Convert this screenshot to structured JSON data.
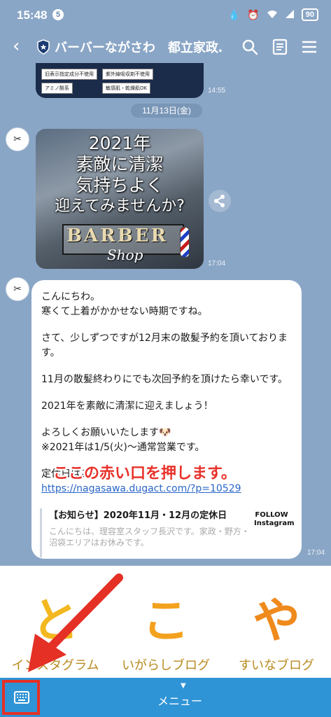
{
  "status_bar": {
    "time": "15:48",
    "notification_count": "5",
    "battery": "90"
  },
  "header": {
    "back_icon": "chevron-left-icon",
    "title": "バーバーながさわ　都立家政…",
    "icons": [
      "search-icon",
      "note-icon",
      "menu-icon"
    ]
  },
  "chat": {
    "top_image": {
      "tags": [
        "旧表示指定成分不使用",
        "紫外線吸収剤不使用",
        "アミノ酸系",
        "敏感肌・乾燥肌OK"
      ],
      "time": "14:55"
    },
    "date_label": "11月13日(金)",
    "image_message": {
      "lines": [
        "2021年",
        "素敵に清潔",
        "気持ちよく",
        "迎えてみませんか?"
      ],
      "logo_text": "BARBER",
      "logo_sub": "Shop",
      "time": "17:04"
    },
    "text_message": {
      "paragraphs": [
        "こんにちわ。\n寒くて上着がかかせない時期ですね。",
        "さて、少しずつですが12月末の散髪予約を頂いております。",
        "11月の散髪終わりにでも次回予約を頂けたら幸いです。",
        "2021年を素敵に清潔に迎えましょう！",
        "よろしくお願いいたします🐶\n※2021年は1/5(火)〜通常営業です。"
      ],
      "link_intro": "定休日はこちら",
      "link_url": "https://nagasawa.dugact.com/?p=10529",
      "link_card_title": "【お知らせ】2020年11月・12月の定休日",
      "link_card_desc": "こんにちは、理容室スタッフ長沢です。家政・野方・沼袋エリアはお休みです。",
      "link_card_logo": "FOLLOW\nInstagram",
      "time": "17:04"
    },
    "overlay_note": "ここの赤い口を押します。"
  },
  "rich_menu": {
    "items": [
      {
        "glyph": "と",
        "label": "インスタグラム",
        "color": "#f3b81f"
      },
      {
        "glyph": "こ",
        "label": "いがらしブログ",
        "color": "#f3a21f"
      },
      {
        "glyph": "や",
        "label": "すいなブログ",
        "color": "#ef8a1c"
      }
    ]
  },
  "bottom_bar": {
    "keyboard_icon": "keyboard-icon",
    "menu_label": "メニュー",
    "menu_arrow": "▼"
  },
  "colors": {
    "chat_bg": "#8aa6c6",
    "bottom_bar": "#2f94d6",
    "highlight_red": "#e53026",
    "link": "#2a66c7"
  }
}
